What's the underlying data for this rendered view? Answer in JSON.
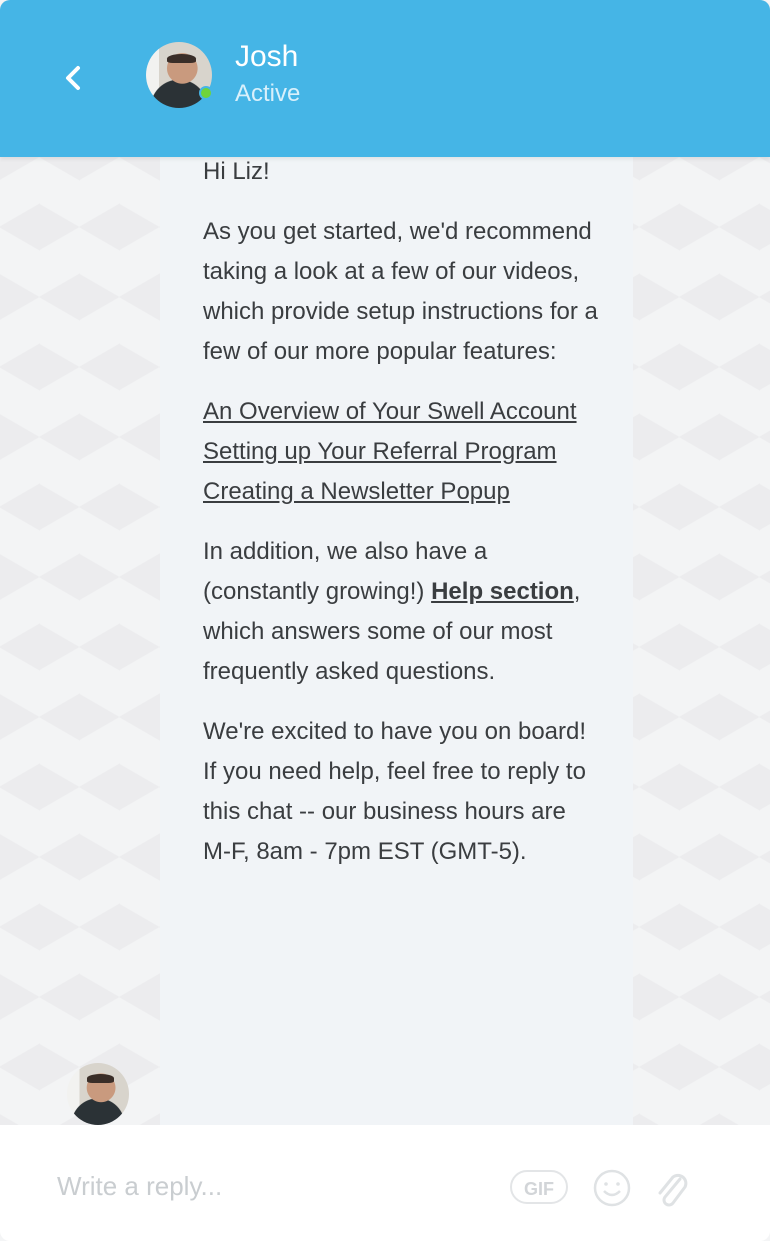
{
  "header": {
    "name": "Josh",
    "status": "Active",
    "status_color": "#6fd43a",
    "bg_color": "#45b5e6"
  },
  "message": {
    "greeting": "Hi Liz!",
    "intro": "As you get started, we'd recommend taking a look at a few of our videos, which provide setup instructions for a few of our more popular features:",
    "links": [
      "An Overview of Your Swell Account",
      "Setting up Your Referral Program",
      "Creating a Newsletter Popup"
    ],
    "help_before": "In addition, we also have a (constantly growing!) ",
    "help_link": "Help section",
    "help_after": ", which answers some of our most frequently asked questions.",
    "closing": "We're excited to have you on board! If you need help, feel free to reply to this chat -- our business hours are M-F, 8am - 7pm EST (GMT-5)."
  },
  "composer": {
    "placeholder": "Write a reply...",
    "gif_label": "GIF"
  }
}
